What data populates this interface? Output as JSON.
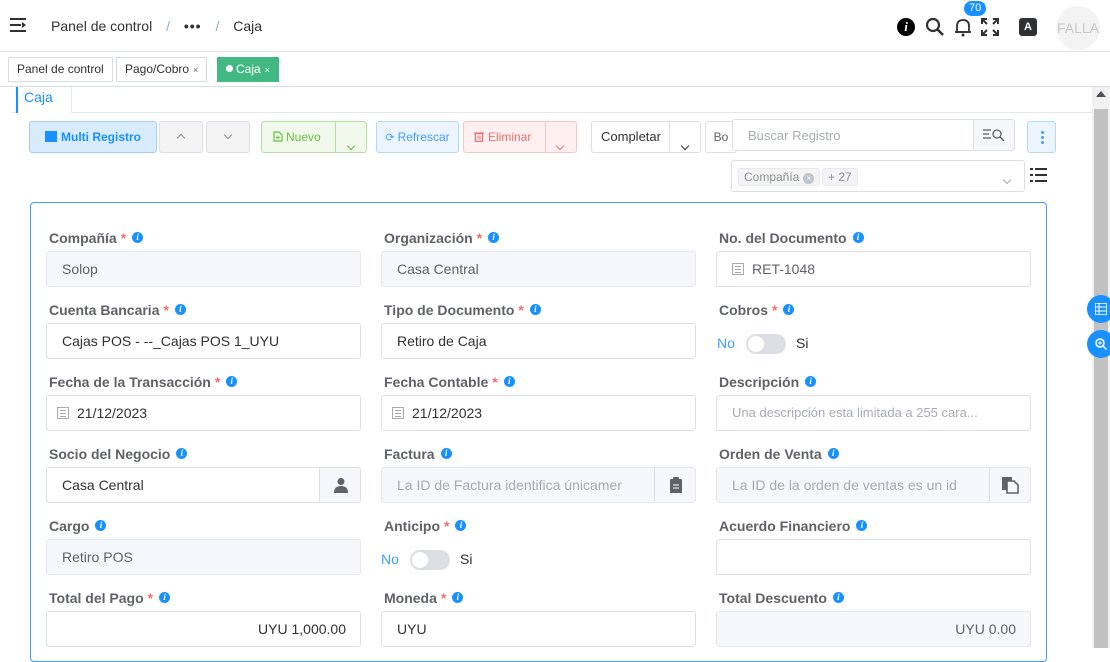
{
  "header": {
    "breadcrumb": {
      "root": "Panel de control",
      "dots": "•••",
      "sep": "/",
      "current": "Caja"
    },
    "notification_count": "70",
    "user_label": "FALLA",
    "translate_glyph": "A"
  },
  "tags": [
    {
      "label": "Panel de control"
    },
    {
      "label": "Pago/Cobro",
      "close": "×"
    },
    {
      "label": "Caja",
      "close": "×",
      "active": true
    }
  ],
  "tab": {
    "label": "Caja"
  },
  "toolbar": {
    "multi_label": "Multi Registro",
    "new_label": "Nuevo",
    "refresh_label": "Refrescar",
    "delete_label": "Eliminar",
    "completar_label": "Completar",
    "bo_label": "Bo",
    "search_placeholder": "Buscar Registro"
  },
  "filter": {
    "chip1": "Compañía",
    "chip2": "+ 27"
  },
  "form": {
    "company": {
      "label": "Compañía",
      "value": "Solop"
    },
    "organization": {
      "label": "Organización",
      "value": "Casa Central"
    },
    "document_no": {
      "label": "No. del Documento",
      "value": "RET-1048"
    },
    "bank_account": {
      "label": "Cuenta Bancaria",
      "value": "Cajas POS - --_Cajas POS 1_UYU"
    },
    "doc_type": {
      "label": "Tipo de Documento",
      "value": "Retiro de Caja"
    },
    "receipts": {
      "label": "Cobros",
      "off": "No",
      "on": "Si"
    },
    "trx_date": {
      "label": "Fecha de la Transacción",
      "value": "21/12/2023"
    },
    "acct_date": {
      "label": "Fecha Contable",
      "value": "21/12/2023"
    },
    "description": {
      "label": "Descripción",
      "placeholder": "Una descripción esta limitada a 255 cara..."
    },
    "bpartner": {
      "label": "Socio del Negocio",
      "value": "Casa Central"
    },
    "invoice": {
      "label": "Factura",
      "placeholder": "La ID de Factura identifica únicamer"
    },
    "sales_order": {
      "label": "Orden de Venta",
      "placeholder": "La ID de la orden de ventas es un id"
    },
    "charge": {
      "label": "Cargo",
      "value": "Retiro POS"
    },
    "prepayment": {
      "label": "Anticipo",
      "off": "No",
      "on": "Si"
    },
    "financial_agreement": {
      "label": "Acuerdo Financiero",
      "value": ""
    },
    "total_payment": {
      "label": "Total del Pago",
      "value": "UYU 1,000.00"
    },
    "currency": {
      "label": "Moneda",
      "value": "UYU"
    },
    "total_discount": {
      "label": "Total Descuento",
      "value": "UYU 0.00"
    }
  },
  "required_mark": "*",
  "info_glyph": "i"
}
